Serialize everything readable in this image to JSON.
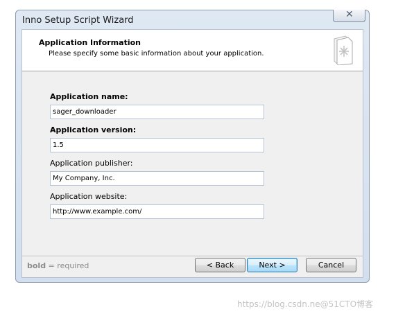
{
  "window": {
    "title": "Inno Setup Script Wizard",
    "close_glyph": "✕"
  },
  "header": {
    "title": "Application Information",
    "subtitle": "Please specify some basic information about your application.",
    "icon": "wizard-document-icon"
  },
  "form": {
    "app_name": {
      "label": "Application name:",
      "value": "sager_downloader"
    },
    "app_version": {
      "label": "Application version:",
      "value": "1.5"
    },
    "app_publisher": {
      "label": "Application publisher:",
      "value": "My Company, Inc."
    },
    "app_website": {
      "label": "Application website:",
      "value": "http://www.example.com/"
    }
  },
  "footer": {
    "note_bold": "bold",
    "note_rest": " = required"
  },
  "buttons": {
    "back": "< Back",
    "next": "Next >",
    "cancel": "Cancel"
  },
  "watermark": "https://blog.csdn.ne@51CTO博客",
  "colors": {
    "window_frame": "#dfe8f3",
    "default_button": "#bee6fd"
  }
}
